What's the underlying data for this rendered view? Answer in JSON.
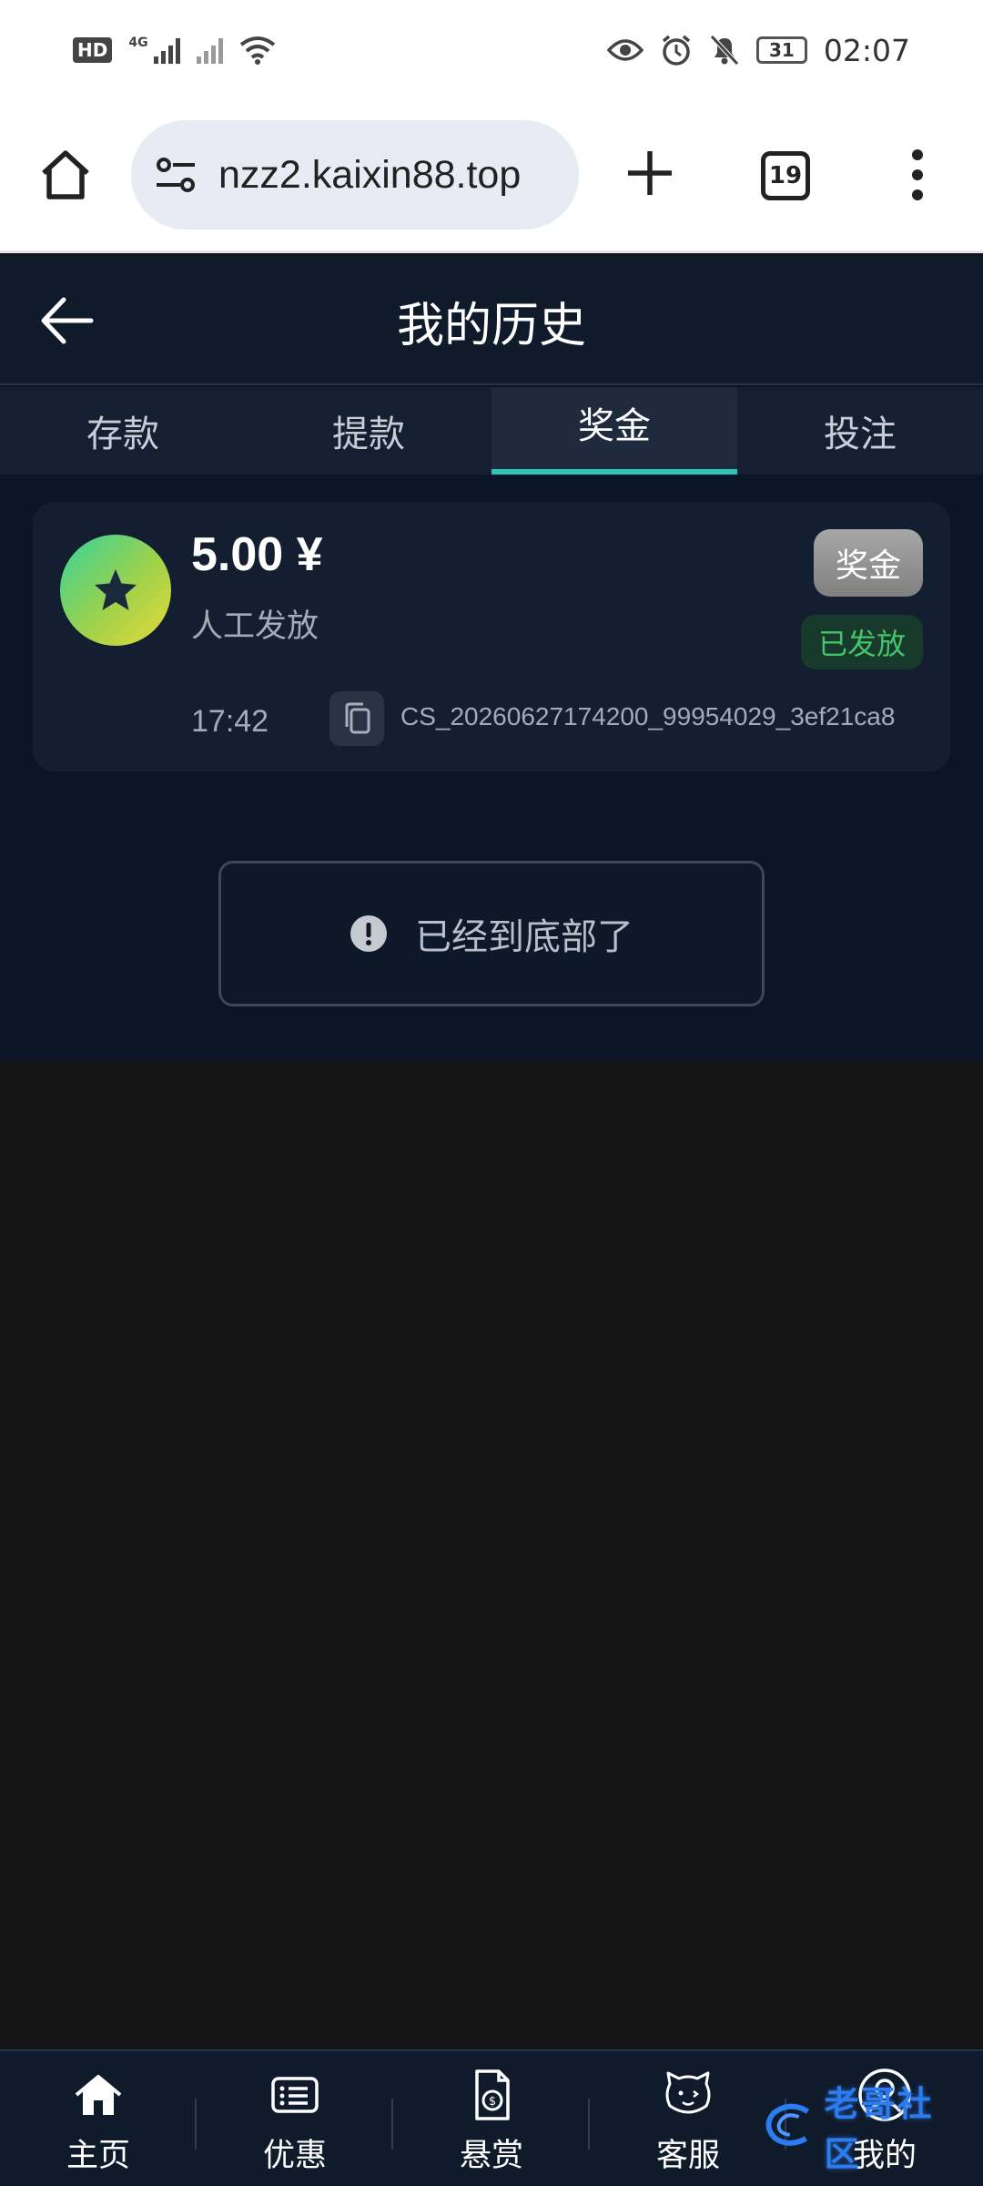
{
  "status_bar": {
    "hd_label": "HD",
    "network_label": "4G",
    "time": "02:07",
    "battery": "31"
  },
  "browser": {
    "url": "nzz2.kaixin88.top",
    "tab_count": "19"
  },
  "header": {
    "title": "我的历史"
  },
  "tabs": [
    {
      "label": "存款",
      "active": false
    },
    {
      "label": "提款",
      "active": false
    },
    {
      "label": "奖金",
      "active": true
    },
    {
      "label": "投注",
      "active": false
    }
  ],
  "records": [
    {
      "amount": "5.00 ¥",
      "source": "人工发放",
      "type": "奖金",
      "status": "已发放",
      "time": "17:42",
      "order_id": "CS_20260627174200_99954029_3ef21ca8"
    }
  ],
  "end_notice": "已经到底部了",
  "bottom_nav": [
    {
      "label": "主页",
      "icon": "home-icon"
    },
    {
      "label": "优惠",
      "icon": "promo-list-icon"
    },
    {
      "label": "悬赏",
      "icon": "reward-doc-icon"
    },
    {
      "label": "客服",
      "icon": "customer-service-icon"
    },
    {
      "label": "我的",
      "icon": "profile-icon"
    }
  ],
  "watermark_text": "老哥社区",
  "colors": {
    "accent": "#2ec4b6",
    "status_green": "#43c46a",
    "app_bg": "#0b1526"
  }
}
